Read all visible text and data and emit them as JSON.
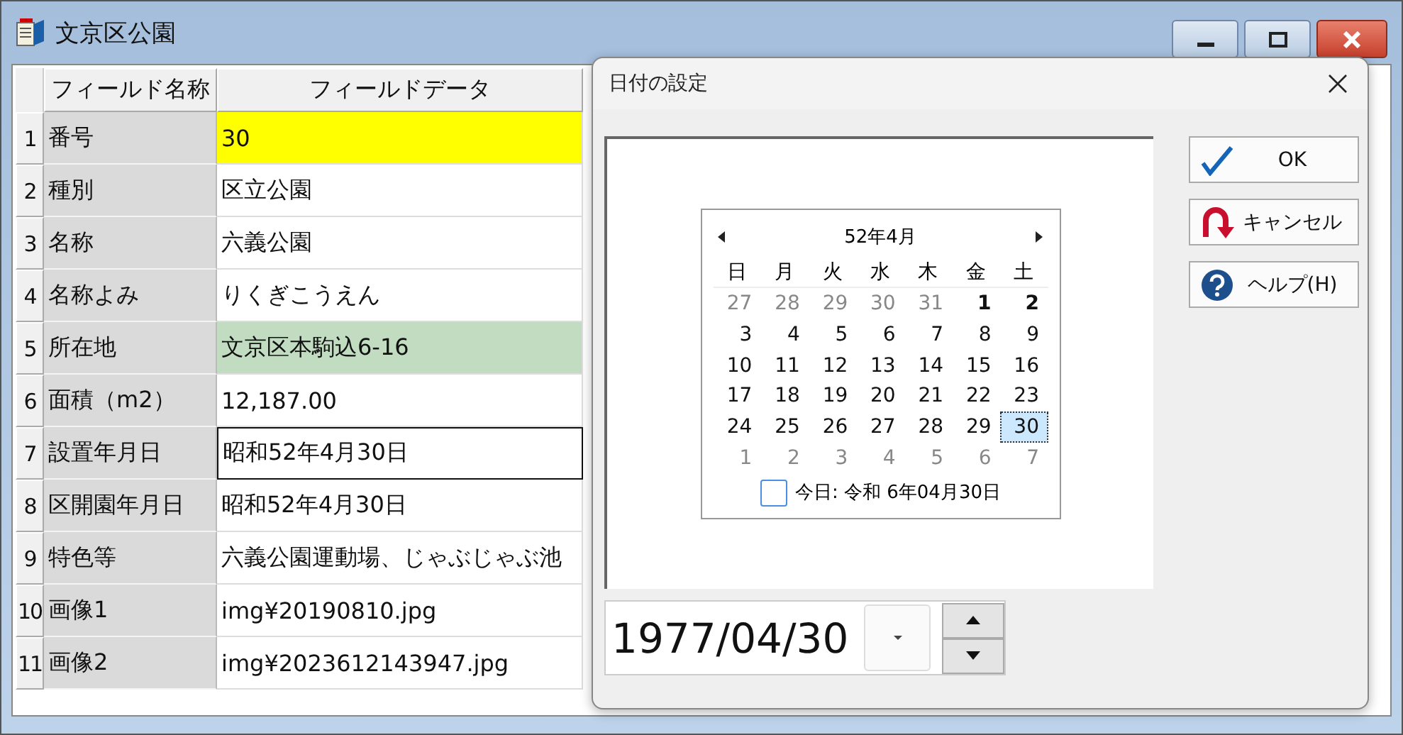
{
  "window": {
    "title": "文京区公園"
  },
  "grid": {
    "columns": [
      "フィールド名称",
      "フィールドデータ"
    ],
    "rows": [
      {
        "number": "1",
        "name": "番号",
        "value": "30",
        "color": "#ffff00",
        "focused": false
      },
      {
        "number": "2",
        "name": "種別",
        "value": "区立公園",
        "focused": false
      },
      {
        "number": "3",
        "name": "名称",
        "value": "六義公園",
        "focused": false
      },
      {
        "number": "4",
        "name": "名称よみ",
        "value": "りくぎこうえん",
        "focused": false
      },
      {
        "number": "5",
        "name": "所在地",
        "value": "文京区本駒込6-16",
        "color": "#c1dcc1",
        "focused": false
      },
      {
        "number": "6",
        "name": "面積（m2）",
        "value": "12,187.00",
        "focused": false
      },
      {
        "number": "7",
        "name": "設置年月日",
        "value": "昭和52年4月30日",
        "focused": true
      },
      {
        "number": "8",
        "name": "区開園年月日",
        "value": "昭和52年4月30日",
        "focused": false
      },
      {
        "number": "9",
        "name": "特色等",
        "value": "六義公園運動場、じゃぶじゃぶ池",
        "focused": false
      },
      {
        "number": "10",
        "name": "画像1",
        "value": "img¥20190810.jpg",
        "focused": false
      },
      {
        "number": "11",
        "name": "画像2",
        "value": "img¥2023612143947.jpg",
        "focused": false
      }
    ]
  },
  "dialog": {
    "title": "日付の設定",
    "calendar": {
      "month": "52年4月",
      "weekdays": [
        "日",
        "月",
        "火",
        "水",
        "木",
        "金",
        "土"
      ],
      "weeks": [
        [
          {
            "day": "27",
            "other": true,
            "bold": false,
            "selected": false
          },
          {
            "day": "28",
            "other": true,
            "bold": false,
            "selected": false
          },
          {
            "day": "29",
            "other": true,
            "bold": false,
            "selected": false
          },
          {
            "day": "30",
            "other": true,
            "bold": false,
            "selected": false
          },
          {
            "day": "31",
            "other": true,
            "bold": false,
            "selected": false
          },
          {
            "day": "1",
            "other": false,
            "bold": true,
            "selected": false
          },
          {
            "day": "2",
            "other": false,
            "bold": true,
            "selected": false
          }
        ],
        [
          {
            "day": "3",
            "other": false,
            "bold": false,
            "selected": false
          },
          {
            "day": "4",
            "other": false,
            "bold": false,
            "selected": false
          },
          {
            "day": "5",
            "other": false,
            "bold": false,
            "selected": false
          },
          {
            "day": "6",
            "other": false,
            "bold": false,
            "selected": false
          },
          {
            "day": "7",
            "other": false,
            "bold": false,
            "selected": false
          },
          {
            "day": "8",
            "other": false,
            "bold": false,
            "selected": false
          },
          {
            "day": "9",
            "other": false,
            "bold": false,
            "selected": false
          }
        ],
        [
          {
            "day": "10",
            "other": false,
            "bold": false,
            "selected": false
          },
          {
            "day": "11",
            "other": false,
            "bold": false,
            "selected": false
          },
          {
            "day": "12",
            "other": false,
            "bold": false,
            "selected": false
          },
          {
            "day": "13",
            "other": false,
            "bold": false,
            "selected": false
          },
          {
            "day": "14",
            "other": false,
            "bold": false,
            "selected": false
          },
          {
            "day": "15",
            "other": false,
            "bold": false,
            "selected": false
          },
          {
            "day": "16",
            "other": false,
            "bold": false,
            "selected": false
          }
        ],
        [
          {
            "day": "17",
            "other": false,
            "bold": false,
            "selected": false
          },
          {
            "day": "18",
            "other": false,
            "bold": false,
            "selected": false
          },
          {
            "day": "19",
            "other": false,
            "bold": false,
            "selected": false
          },
          {
            "day": "20",
            "other": false,
            "bold": false,
            "selected": false
          },
          {
            "day": "21",
            "other": false,
            "bold": false,
            "selected": false
          },
          {
            "day": "22",
            "other": false,
            "bold": false,
            "selected": false
          },
          {
            "day": "23",
            "other": false,
            "bold": false,
            "selected": false
          }
        ],
        [
          {
            "day": "24",
            "other": false,
            "bold": false,
            "selected": false
          },
          {
            "day": "25",
            "other": false,
            "bold": false,
            "selected": false
          },
          {
            "day": "26",
            "other": false,
            "bold": false,
            "selected": false
          },
          {
            "day": "27",
            "other": false,
            "bold": false,
            "selected": false
          },
          {
            "day": "28",
            "other": false,
            "bold": false,
            "selected": false
          },
          {
            "day": "29",
            "other": false,
            "bold": false,
            "selected": false
          },
          {
            "day": "30",
            "other": false,
            "bold": false,
            "selected": true
          }
        ],
        [
          {
            "day": "1",
            "other": true,
            "bold": false,
            "selected": false
          },
          {
            "day": "2",
            "other": true,
            "bold": false,
            "selected": false
          },
          {
            "day": "3",
            "other": true,
            "bold": false,
            "selected": false
          },
          {
            "day": "4",
            "other": true,
            "bold": false,
            "selected": false
          },
          {
            "day": "5",
            "other": true,
            "bold": false,
            "selected": false
          },
          {
            "day": "6",
            "other": true,
            "bold": false,
            "selected": false
          },
          {
            "day": "7",
            "other": true,
            "bold": false,
            "selected": false
          }
        ]
      ],
      "today": {
        "label": "今日: 令和 6年04月30日",
        "checked": false
      }
    },
    "date_field": {
      "value": "1977/04/30"
    },
    "buttons": [
      {
        "kind": "ok",
        "label": "OK"
      },
      {
        "kind": "cancel",
        "label": "キャンセル"
      },
      {
        "kind": "help",
        "label": "ヘルプ(H)"
      }
    ]
  }
}
